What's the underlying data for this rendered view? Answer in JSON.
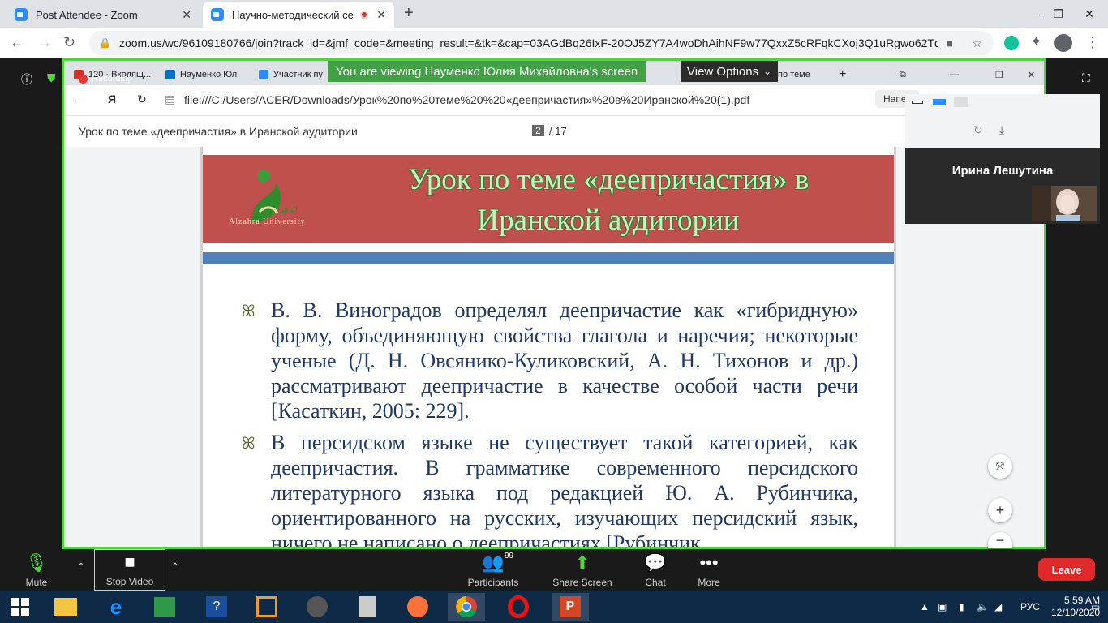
{
  "browser": {
    "tabs": [
      {
        "title": "Post Attendee - Zoom"
      },
      {
        "title": "Научно-методический семинар"
      }
    ],
    "url": "zoom.us/wc/96109180766/join?track_id=&jmf_code=&meeting_result=&tk=&cap=03AGdBq26IxF-20OJ5ZY7A4woDhAihNF9w77QxxZ5cRFqkCXoj3Q1uRgwo62Tq..."
  },
  "shared_screen": {
    "banner": "You are viewing Науменко Юлия Михайловна's screen",
    "view_options": "View Options",
    "recording": "Recording",
    "inner_tabs": [
      {
        "title": "120 · Входящ..."
      },
      {
        "title": "Науменко Юл"
      },
      {
        "title": "Участник пу"
      },
      {
        "title": "по теме"
      }
    ],
    "inner_url": "file:///C:/Users/ACER/Downloads/Урок%20по%20теме%20%20«деепричастия»%20в%20Иранской%20(1).pdf",
    "inner_right_btn": "Напеч",
    "pdf_title": "Урок по теме «деепричастия» в Иранской аудитории",
    "page_current": "2",
    "page_total": "/ 17",
    "slide": {
      "title_line1": "Урок по теме  «деепричастия» в",
      "title_line2": "Иранской аудитории",
      "logo_text": "Alzahra University",
      "bullets": [
        "В. В. Виноградов определял деепричастие как «гибридную» форму, объединяющую свойства глагола и наречия; некоторые ученые (Д. Н. Овсянико-Куликовский, А. Н. Тихонов и др.) рассматривают деепричастие в качестве особой части речи [Касаткин, 2005: 229].",
        "В персидском языке не существует такой категорией, как деепричастия. В грамматике современного персидского литературного языка под редакцией Ю. А. Рубинчика, ориентированного на русских, изучающих персидский язык, ничего не написано о деепричастиях [Рубинчик,"
      ]
    }
  },
  "participant": {
    "name": "Ирина Лешутина"
  },
  "controls": {
    "mute": "Mute",
    "stop_video": "Stop Video",
    "participants": "Participants",
    "participants_count": "99",
    "share_screen": "Share Screen",
    "chat": "Chat",
    "more": "More",
    "leave": "Leave"
  },
  "taskbar": {
    "language": "РУС",
    "time": "5:59 AM",
    "date": "12/10/2020"
  }
}
